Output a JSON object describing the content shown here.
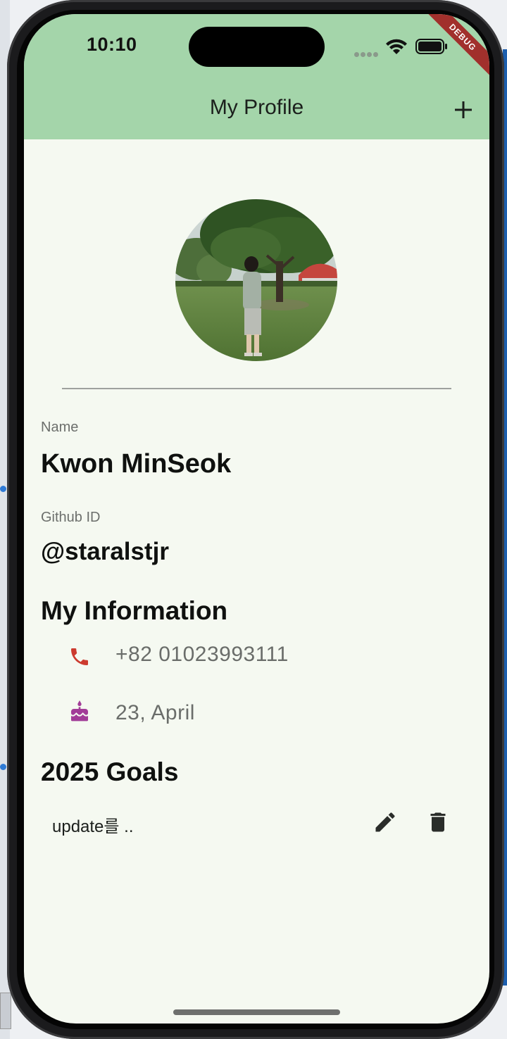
{
  "status_bar": {
    "time": "10:10",
    "debug_banner": "DEBUG"
  },
  "app_bar": {
    "title": "My Profile",
    "add_icon": "plus-icon",
    "background": "#a4d5aa"
  },
  "profile": {
    "photo": "profile-photo",
    "name_label": "Name",
    "name_value": "Kwon MinSeok",
    "github_label": "Github ID",
    "github_value": "@staralstjr"
  },
  "my_information": {
    "heading": "My Information",
    "items": [
      {
        "icon": "phone-icon",
        "icon_color": "#cc3b2f",
        "text": "+82 01023993111"
      },
      {
        "icon": "cake-icon",
        "icon_color": "#a23d98",
        "text": "23, April"
      }
    ]
  },
  "goals": {
    "heading": "2025 Goals",
    "items": [
      {
        "text": "update를 ..",
        "edit_icon": "pencil-icon",
        "delete_icon": "trash-icon"
      }
    ]
  }
}
